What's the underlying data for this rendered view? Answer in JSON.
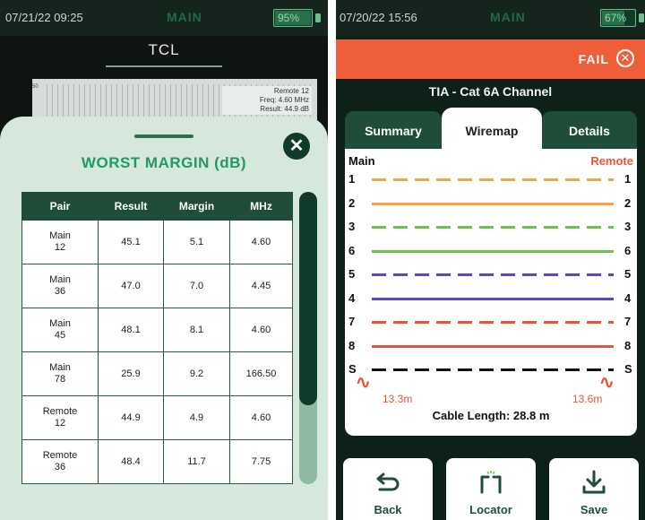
{
  "left": {
    "status": {
      "datetime": "07/21/22 09:25",
      "mode": "MAIN",
      "battery": "95%",
      "battery_level": 0.95
    },
    "title": "TCL",
    "chart": {
      "axis_label": "50",
      "tooltip": [
        "Remote 12",
        "Freq: 4.60 MHz",
        "Result: 44.9 dB"
      ]
    },
    "sheet": {
      "title": "WORST MARGIN (dB)",
      "close_icon": "close-icon",
      "columns": [
        "Pair",
        "Result",
        "Margin",
        "MHz"
      ],
      "rows": [
        {
          "pair_top": "Main",
          "pair_bottom": "12",
          "result": "45.1",
          "margin": "5.1",
          "mhz": "4.60"
        },
        {
          "pair_top": "Main",
          "pair_bottom": "36",
          "result": "47.0",
          "margin": "7.0",
          "mhz": "4.45"
        },
        {
          "pair_top": "Main",
          "pair_bottom": "45",
          "result": "48.1",
          "margin": "8.1",
          "mhz": "4.60"
        },
        {
          "pair_top": "Main",
          "pair_bottom": "78",
          "result": "25.9",
          "margin": "9.2",
          "mhz": "166.50"
        },
        {
          "pair_top": "Remote",
          "pair_bottom": "12",
          "result": "44.9",
          "margin": "4.9",
          "mhz": "4.60"
        },
        {
          "pair_top": "Remote",
          "pair_bottom": "36",
          "result": "48.4",
          "margin": "11.7",
          "mhz": "7.75"
        }
      ]
    }
  },
  "right": {
    "status": {
      "datetime": "07/20/22 15:56",
      "mode": "MAIN",
      "battery": "67%",
      "battery_level": 0.67
    },
    "fail": {
      "label": "FAIL",
      "icon": "x-circle-icon",
      "color": "#ee5f39"
    },
    "channel": "TIA - Cat 6A Channel",
    "tabs": {
      "summary": "Summary",
      "wiremap": "Wiremap",
      "details": "Details",
      "active": "Wiremap"
    },
    "wiremap": {
      "main_label": "Main",
      "remote_label": "Remote",
      "wires": [
        {
          "left": "1",
          "right": "1",
          "color": "#f4a340",
          "style": "dashed"
        },
        {
          "left": "2",
          "right": "2",
          "color": "#f4a340",
          "style": "solid"
        },
        {
          "left": "3",
          "right": "3",
          "color": "#6cc24a",
          "style": "dashed"
        },
        {
          "left": "6",
          "right": "6",
          "color": "#6cc24a",
          "style": "solid"
        },
        {
          "left": "5",
          "right": "5",
          "color": "#5b47c6",
          "style": "dashed"
        },
        {
          "left": "4",
          "right": "4",
          "color": "#5b47c6",
          "style": "solid"
        },
        {
          "left": "7",
          "right": "7",
          "color": "#e6553a",
          "style": "dashed"
        },
        {
          "left": "8",
          "right": "8",
          "color": "#e6553a",
          "style": "solid"
        },
        {
          "left": "S",
          "right": "S",
          "color": "#111111",
          "style": "dashed"
        }
      ],
      "left_distance": "13.3m",
      "right_distance": "13.6m",
      "cable_length": "Cable Length: 28.8 m"
    },
    "buttons": {
      "back": {
        "label": "Back",
        "icon": "back-arrow-icon"
      },
      "locator": {
        "label": "Locator",
        "icon": "locator-icon"
      },
      "save": {
        "label": "Save",
        "icon": "download-icon"
      }
    }
  }
}
